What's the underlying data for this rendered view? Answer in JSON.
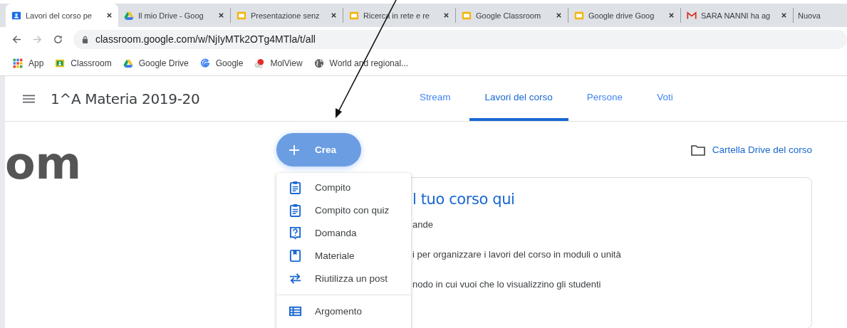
{
  "browser": {
    "tabs": [
      {
        "label": "Lavori del corso pe",
        "kind": "classroom",
        "selected": true
      },
      {
        "label": "Il mio Drive - Goog",
        "kind": "drive",
        "selected": false
      },
      {
        "label": "Presentazione senz",
        "kind": "slides",
        "selected": false
      },
      {
        "label": "Ricerca in rete e re",
        "kind": "slides",
        "selected": false
      },
      {
        "label": "Google Classroom",
        "kind": "slides",
        "selected": false
      },
      {
        "label": "Google drive Goog",
        "kind": "slides",
        "selected": false
      },
      {
        "label": "SARA NANNI ha ag",
        "kind": "gmail",
        "selected": false
      },
      {
        "label": "Nuova",
        "kind": "new",
        "selected": false
      }
    ],
    "url": "classroom.google.com/w/NjIyMTk2OTg4MTla/t/all",
    "bookmarks": [
      {
        "label": "App",
        "kind": "apps"
      },
      {
        "label": "Classroom",
        "kind": "classroom"
      },
      {
        "label": "Google Drive",
        "kind": "drive"
      },
      {
        "label": "Google",
        "kind": "google"
      },
      {
        "label": "MolView",
        "kind": "molview"
      },
      {
        "label": "World and regional...",
        "kind": "globe"
      }
    ]
  },
  "app": {
    "course_title": "1^A Materia 2019-20",
    "nav_tabs": [
      {
        "label": "Stream",
        "selected": false
      },
      {
        "label": "Lavori del corso",
        "selected": true
      },
      {
        "label": "Persone",
        "selected": false
      },
      {
        "label": "Voti",
        "selected": false
      }
    ],
    "background_text": "om",
    "create_button": "Crea",
    "drive_folder_link": "Cartella Drive del corso",
    "create_menu": {
      "groups": [
        [
          {
            "label": "Compito",
            "kind": "assignment"
          },
          {
            "label": "Compito con quiz",
            "kind": "assignment"
          },
          {
            "label": "Domanda",
            "kind": "question"
          },
          {
            "label": "Materiale",
            "kind": "material"
          },
          {
            "label": "Riutilizza un post",
            "kind": "reuse"
          }
        ],
        [
          {
            "label": "Argomento",
            "kind": "topic"
          }
        ]
      ]
    },
    "card": {
      "title": "l tuo corso qui",
      "lines": [
        "ande",
        "i per organizzare i lavori del corso in moduli o unità",
        "nodo in cui vuoi che lo visualizzino gli studenti"
      ]
    }
  }
}
